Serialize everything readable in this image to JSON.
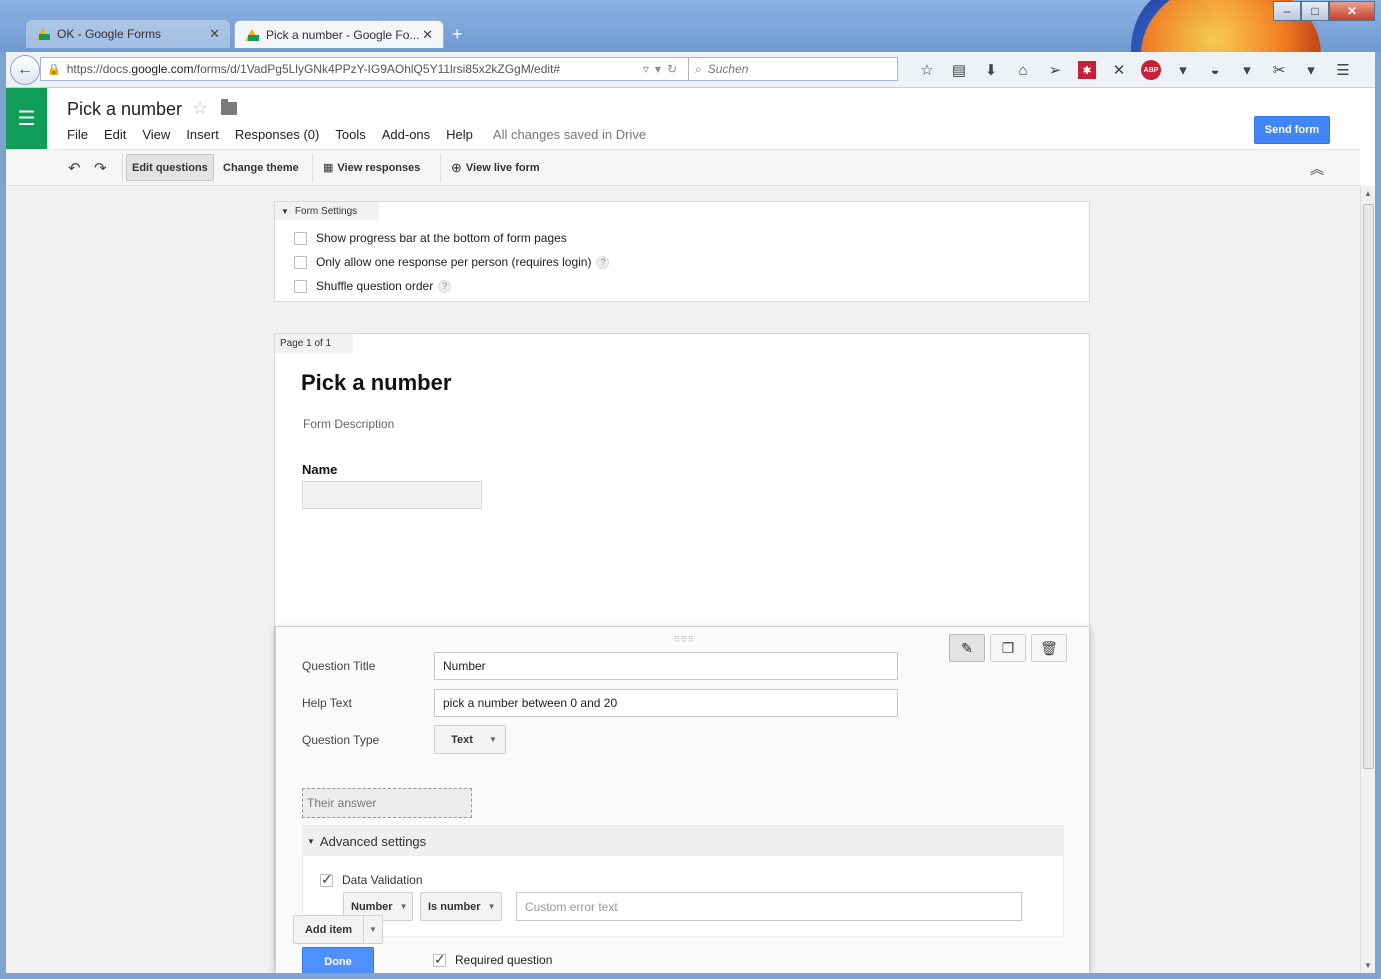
{
  "browser": {
    "tabs": [
      {
        "label": "OK - Google Forms",
        "active": false
      },
      {
        "label": "Pick a number - Google Fo...",
        "active": true
      }
    ],
    "url_prefix": "https://docs.",
    "url_domain": "google.com",
    "url_rest": "/forms/d/1VadPg5LlyGNk4PPzY-IG9AOhlQ5Y11lrsi85x2kZGgM/edit#",
    "search_placeholder": "Suchen",
    "abp": "ABP"
  },
  "app": {
    "doc_title": "Pick a number",
    "menus": [
      "File",
      "Edit",
      "View",
      "Insert",
      "Responses (0)",
      "Tools",
      "Add-ons",
      "Help"
    ],
    "saved_status": "All changes saved in Drive",
    "send_label": "Send form"
  },
  "toolbar": {
    "edit_questions": "Edit questions",
    "change_theme": "Change theme",
    "view_responses": "View responses",
    "view_live_form": "View live form"
  },
  "form_settings": {
    "tab_label": "Form Settings",
    "options": [
      {
        "label": "Show progress bar at the bottom of form pages",
        "checked": false,
        "help": false
      },
      {
        "label": "Only allow one response per person (requires login)",
        "checked": false,
        "help": true
      },
      {
        "label": "Shuffle question order",
        "checked": false,
        "help": true
      }
    ],
    "help_glyph": "?"
  },
  "form": {
    "page_label": "Page 1 of 1",
    "title": "Pick a number",
    "description": "Form Description",
    "name_question": "Name"
  },
  "editor": {
    "question_title_label": "Question Title",
    "question_title_value": "Number",
    "help_text_label": "Help Text",
    "help_text_value": "pick a number between 0 and 20",
    "question_type_label": "Question Type",
    "question_type_value": "Text",
    "their_answer": "Their answer",
    "advanced_label": "Advanced settings",
    "data_validation_label": "Data Validation",
    "data_validation_checked": true,
    "validation_type": "Number",
    "validation_rule": "Is number",
    "custom_error_placeholder": "Custom error text",
    "done_label": "Done",
    "required_label": "Required question",
    "required_checked": true
  },
  "add_item_label": "Add item"
}
